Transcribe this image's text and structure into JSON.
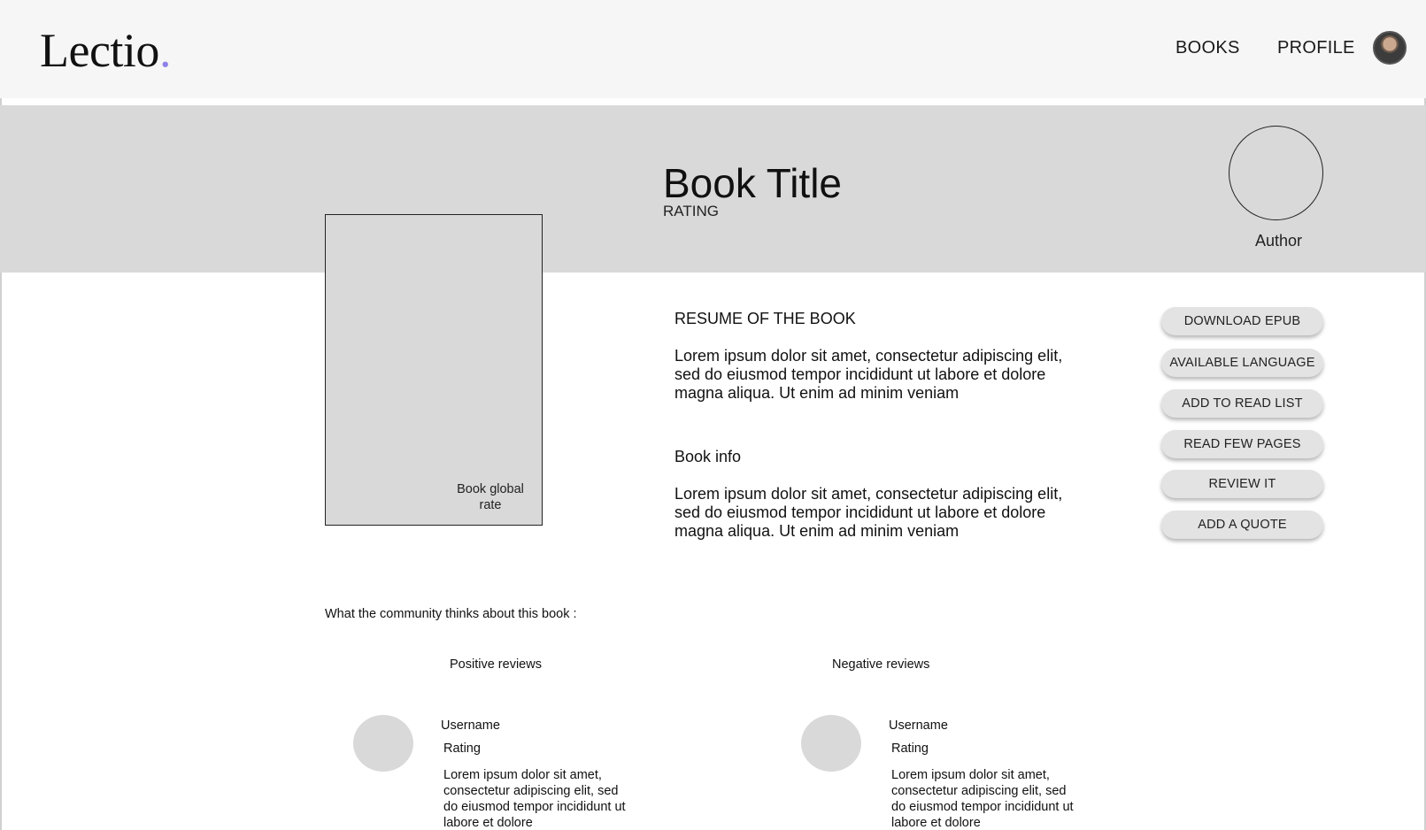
{
  "header": {
    "logo_text": "Lectio",
    "logo_dot": ".",
    "logo_dot_color": "#8d82e8",
    "nav": [
      "BOOKS",
      "PROFILE"
    ],
    "avatar_icon": "user-avatar-photo"
  },
  "book": {
    "title": "Book Title",
    "rating_label": "RATING",
    "author_label": "Author",
    "cover_rate_label": "Book global rate"
  },
  "resume": {
    "heading": "RESUME OF THE BOOK",
    "body": "Lorem ipsum dolor sit amet, consectetur adipiscing elit, sed do eiusmod tempor incididunt ut labore et dolore magna aliqua. Ut enim ad minim veniam"
  },
  "info": {
    "heading": "Book info",
    "body": "Lorem ipsum dolor sit amet, consectetur adipiscing elit, sed do eiusmod tempor incididunt ut labore et dolore magna aliqua. Ut enim ad minim veniam"
  },
  "actions": [
    "DOWNLOAD EPUB",
    "AVAILABLE LANGUAGE",
    "ADD TO READ LIST",
    "READ FEW PAGES",
    "REVIEW IT",
    "ADD A QUOTE"
  ],
  "community": {
    "heading": "What the community thinks about this book :",
    "positive": {
      "heading": "Positive reviews",
      "username": "Username",
      "rating": "Rating",
      "text": "Lorem ipsum dolor sit amet, consectetur adipiscing elit, sed do eiusmod tempor incididunt ut labore et dolore"
    },
    "negative": {
      "heading": "Negative reviews",
      "username": "Username",
      "rating": "Rating",
      "text": "Lorem ipsum dolor sit amet, consectetur adipiscing elit, sed do eiusmod tempor incididunt ut labore et dolore"
    }
  },
  "colors": {
    "header_bg": "#f6f6f6",
    "hero_bg": "#d9d9d9",
    "button_bg": "#e3e3e3"
  }
}
